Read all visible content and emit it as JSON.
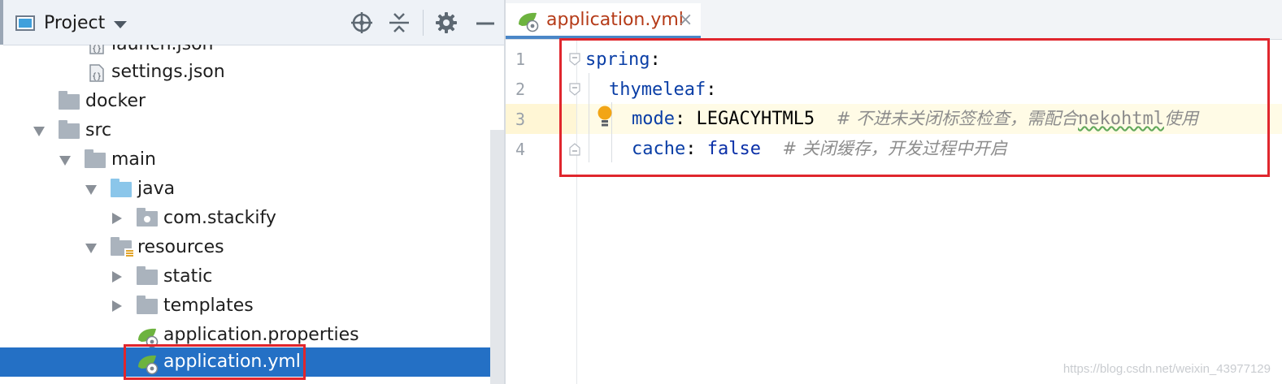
{
  "project_panel": {
    "title": "Project",
    "header_icons": [
      "locate-icon",
      "collapse-all-icon",
      "gear-icon",
      "hide-icon"
    ]
  },
  "tree": [
    {
      "label": "launch.json",
      "type": "json-file",
      "depth": 3
    },
    {
      "label": "settings.json",
      "type": "json-file",
      "depth": 3
    },
    {
      "label": "docker",
      "type": "folder",
      "depth": 2
    },
    {
      "label": "src",
      "type": "folder",
      "expanded": true,
      "depth": 1
    },
    {
      "label": "main",
      "type": "folder",
      "expanded": true,
      "depth": 2
    },
    {
      "label": "java",
      "type": "source-folder",
      "expanded": true,
      "depth": 3
    },
    {
      "label": "com.stackify",
      "type": "package",
      "expanded": false,
      "depth": 4
    },
    {
      "label": "resources",
      "type": "resources-folder",
      "expanded": true,
      "depth": 3
    },
    {
      "label": "static",
      "type": "folder",
      "expanded": false,
      "depth": 4
    },
    {
      "label": "templates",
      "type": "folder",
      "expanded": false,
      "depth": 4
    },
    {
      "label": "application.properties",
      "type": "spring-config",
      "depth": 4
    },
    {
      "label": "application.yml",
      "type": "spring-config",
      "depth": 4,
      "selected": true
    }
  ],
  "editor": {
    "tab": {
      "label": "application.yml",
      "close": "×"
    },
    "line_numbers": [
      "1",
      "2",
      "3",
      "4"
    ],
    "lines": {
      "l1": {
        "key": "spring",
        "colon": ":"
      },
      "l2": {
        "key": "thymeleaf",
        "colon": ":"
      },
      "l3": {
        "key": "mode",
        "colon": ": ",
        "value": "LEGACYHTML5",
        "comment_a": "# 不进未关闭标签检查，需配合",
        "comment_mono": "nekohtml",
        "comment_b": "使用"
      },
      "l4": {
        "key": "cache",
        "colon": ": ",
        "value": "false",
        "comment": "# 关闭缓存，开发过程中开启"
      }
    }
  },
  "watermark": "https://blog.csdn.net/weixin_43977129",
  "colors": {
    "selection": "#2470c5",
    "highlight_box": "#e0262d",
    "yaml_key": "#0a3ea6",
    "tab_text": "#b53b18",
    "comment": "#8c8c8c"
  }
}
